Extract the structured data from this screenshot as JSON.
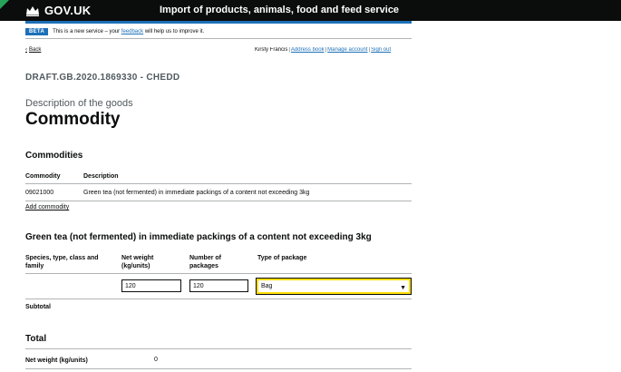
{
  "header": {
    "logo_text": "GOV.UK",
    "service_name": "Import of products, animals, food and feed service"
  },
  "phase_banner": {
    "tag": "BETA",
    "text_before": "This is a new service – your",
    "link": "feedback",
    "text_after": "will help us to improve it."
  },
  "nav": {
    "back": "Back",
    "user_name": "Kirsty Francis",
    "links": [
      "Address book",
      "Manage account",
      "Sign out"
    ]
  },
  "page": {
    "reference": "DRAFT.GB.2020.1869330 - CHEDD",
    "caption": "Description of the goods",
    "title": "Commodity"
  },
  "commodities": {
    "heading": "Commodities",
    "columns": [
      "Commodity",
      "Description"
    ],
    "rows": [
      {
        "code": "09021000",
        "description": "Green tea (not fermented) in immediate packings of a content not exceeding 3kg"
      }
    ],
    "add_link": "Add commodity"
  },
  "detail": {
    "heading": "Green tea (not fermented) in immediate packings of a content not exceeding 3kg",
    "columns": {
      "species": "Species, type, class and family",
      "net_weight": "Net weight (kg/units)",
      "packages": "Number of packages",
      "package_type": "Type of package"
    },
    "net_weight_value": "120",
    "packages_value": "120",
    "package_type_value": "Bag",
    "subtotal_label": "Subtotal"
  },
  "total": {
    "heading": "Total",
    "net_weight_label": "Net weight (kg/units)",
    "net_weight_value": "0"
  },
  "colors": {
    "header_bg": "#0b0c0c",
    "header_bar": "#1d70b8",
    "link": "#1d70b8",
    "focus": "#ffdd00",
    "corner_accent": "#27a35a"
  }
}
